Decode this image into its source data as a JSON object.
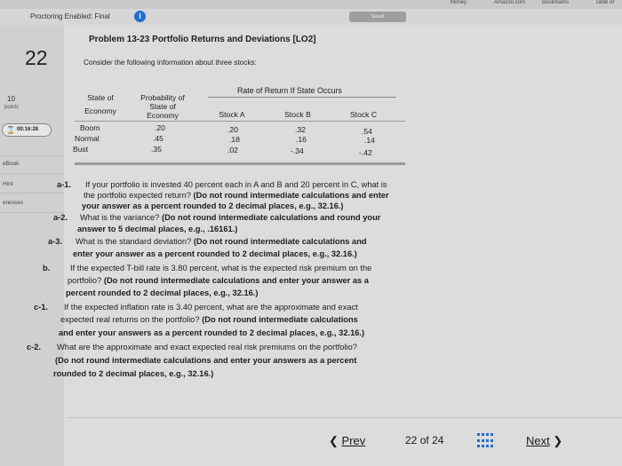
{
  "browser": {
    "bookmarks_label": "Bookmarks",
    "tab_items": [
      "Money",
      "Amazon.com",
      "Table of"
    ]
  },
  "header": {
    "proctoring_text": "Proctoring Enabled: Final",
    "saved_label": "Saved",
    "info_icon": "info-icon"
  },
  "sidebar": {
    "question_number": "22",
    "points_value": "10",
    "points_label": "points",
    "timer": "00:16:28",
    "links": [
      "eBook",
      "Hint",
      "erences"
    ]
  },
  "problem": {
    "title": "Problem 13-23 Portfolio Returns and Deviations [LO2]",
    "intro": "Consider the following information about three stocks:"
  },
  "table": {
    "group_header": "Rate of Return If State Occurs",
    "col1_header": [
      "State of",
      "Economy"
    ],
    "col2_header": [
      "Probability of",
      "State of",
      "Economy"
    ],
    "col3_header": "Stock A",
    "col4_header": "Stock B",
    "col5_header": "Stock C",
    "rows": [
      {
        "state": "Boom",
        "prob": ".20",
        "a": ".20",
        "b": ".32",
        "c": ".54"
      },
      {
        "state": "Normal",
        "prob": ".45",
        "a": ".18",
        "b": ".16",
        "c": ".14"
      },
      {
        "state": "Bust",
        "prob": ".35",
        "a": ".02",
        "b": "-.34",
        "c": "-.42"
      }
    ]
  },
  "questions": {
    "a1_label": "a-1.",
    "a1_l1": "If your portfolio is invested 40 percent each in A and B and 20 percent in C, what is",
    "a1_l2a": "the portfolio expected return? ",
    "a1_l2b": "(Do not round intermediate calculations and enter",
    "a1_l3": "your answer as a percent rounded to 2 decimal places, e.g., 32.16.)",
    "a2_label": "a-2.",
    "a2_l1a": "What is the variance? ",
    "a2_l1b": "(Do not round intermediate calculations and round your",
    "a2_l2": "answer to 5 decimal places, e.g., .16161.)",
    "a3_label": "a-3.",
    "a3_l1a": "What is the standard deviation? ",
    "a3_l1b": "(Do not round intermediate calculations and",
    "a3_l2": "enter your answer as a percent rounded to 2 decimal places, e.g., 32.16.)",
    "b_label": "b.",
    "b_l1": "If the expected T-bill rate is 3.80 percent, what is the expected risk premium on the",
    "b_l2a": "portfolio? ",
    "b_l2b": "(Do not round intermediate calculations and enter your answer as a",
    "b_l3": "percent rounded to 2 decimal places, e.g., 32.16.)",
    "c1_label": "c-1.",
    "c1_l1": "If the expected inflation rate is 3.40 percent, what are the approximate and exact",
    "c1_l2a": "expected real returns on the portfolio? ",
    "c1_l2b": "(Do not round intermediate calculations",
    "c1_l3": "and enter your answers as a percent rounded to 2 decimal places, e.g., 32.16.)",
    "c2_label": "c-2.",
    "c2_l1": "What are the approximate and exact expected real risk premiums on the portfolio?",
    "c2_l2": "(Do not round intermediate calculations and enter your answers as a percent",
    "c2_l3": "rounded to 2 decimal places, e.g., 32.16.)"
  },
  "nav": {
    "prev_label": "Prev",
    "current_page": "22",
    "of_label": "of",
    "total_pages": "24",
    "next_label": "Next"
  }
}
